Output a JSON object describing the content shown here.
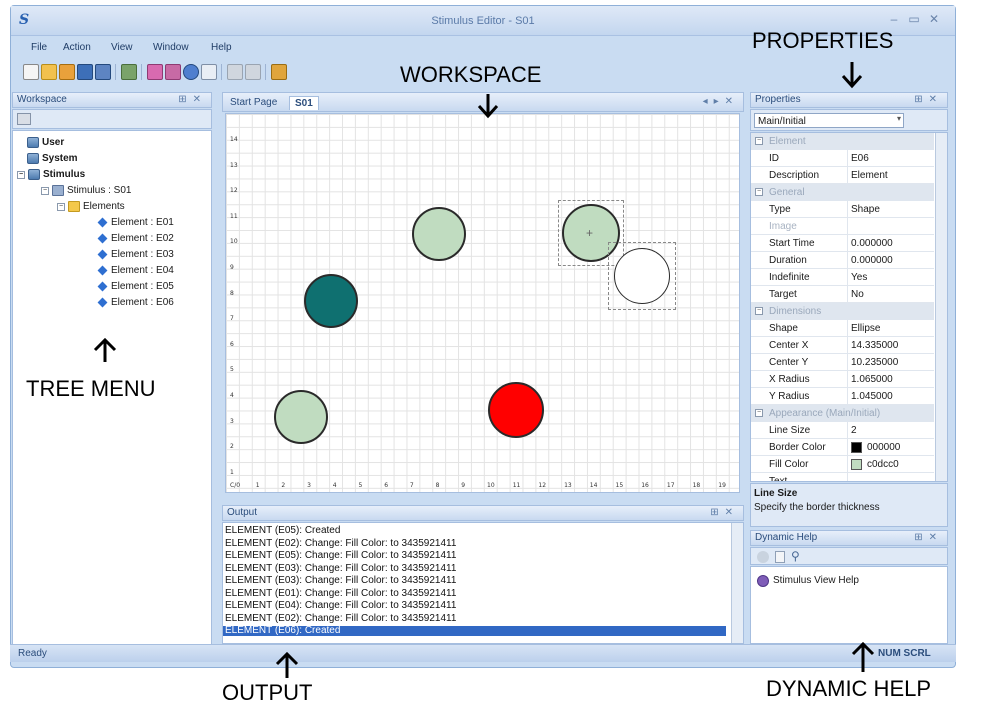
{
  "window": {
    "title": "Stimulus Editor - S01",
    "logo": "S"
  },
  "menu": [
    "File",
    "Action",
    "View",
    "Window",
    "Help"
  ],
  "workspace_panel": {
    "title": "Workspace",
    "tree": {
      "roots": [
        "User",
        "System",
        "Stimulus"
      ],
      "stimulus": "Stimulus : S01",
      "elements_folder": "Elements",
      "elements": [
        "Element : E01",
        "Element : E02",
        "Element : E03",
        "Element : E04",
        "Element : E05",
        "Element : E06"
      ]
    }
  },
  "doc_tabs": [
    "Start Page",
    "S01"
  ],
  "canvas": {
    "x_ticks": [
      "C/0",
      "1",
      "2",
      "3",
      "4",
      "5",
      "6",
      "7",
      "8",
      "9",
      "10",
      "11",
      "12",
      "13",
      "14",
      "15",
      "16",
      "17",
      "18",
      "19"
    ],
    "y_ticks": [
      "14",
      "13",
      "12",
      "11",
      "10",
      "9",
      "8",
      "7",
      "6",
      "5",
      "4",
      "3",
      "2",
      "1"
    ],
    "colors": {
      "light_green": "#c0dcc0",
      "teal": "#0f7070",
      "red": "#ff0000",
      "white": "#ffffff"
    }
  },
  "output_panel": {
    "title": "Output",
    "lines": [
      "ELEMENT (E05): Created",
      "ELEMENT (E02): Change: Fill Color: to 3435921411",
      "ELEMENT (E05): Change: Fill Color: to 3435921411",
      "ELEMENT (E03): Change: Fill Color: to 3435921411",
      "ELEMENT (E03): Change: Fill Color: to 3435921411",
      "ELEMENT (E01): Change: Fill Color: to 3435921411",
      "ELEMENT (E04): Change: Fill Color: to 3435921411",
      "ELEMENT (E02): Change: Fill Color: to 3435921411",
      "ELEMENT (E06): Created"
    ]
  },
  "properties_panel": {
    "title": "Properties",
    "dropdown": "Main/Initial",
    "categories": {
      "element": "Element",
      "general": "General",
      "dimensions": "Dimensions",
      "appearance": "Appearance (Main/Initial)"
    },
    "element_rows": [
      {
        "k": "ID",
        "v": "E06"
      },
      {
        "k": "Description",
        "v": "Element"
      }
    ],
    "general_rows": [
      {
        "k": "Type",
        "v": "Shape"
      },
      {
        "k": "Image",
        "v": ""
      },
      {
        "k": "Start Time",
        "v": "0.000000"
      },
      {
        "k": "Duration",
        "v": "0.000000"
      },
      {
        "k": "Indefinite",
        "v": "Yes"
      },
      {
        "k": "Target",
        "v": "No"
      }
    ],
    "dimension_rows": [
      {
        "k": "Shape",
        "v": "Ellipse"
      },
      {
        "k": "Center X",
        "v": "14.335000"
      },
      {
        "k": "Center Y",
        "v": "10.235000"
      },
      {
        "k": "X Radius",
        "v": "1.065000"
      },
      {
        "k": "Y Radius",
        "v": "1.045000"
      }
    ],
    "appearance_rows": [
      {
        "k": "Line Size",
        "v": "2"
      },
      {
        "k": "Border Color",
        "v": "000000"
      },
      {
        "k": "Fill Color",
        "v": "c0dcc0"
      },
      {
        "k": "Text",
        "v": ""
      }
    ],
    "border_swatch": "#000000",
    "fill_swatch": "#c0dcc0",
    "help_title": "Line Size",
    "help_text": "Specify the border thickness"
  },
  "dynamic_help": {
    "title": "Dynamic Help",
    "link": "Stimulus View Help"
  },
  "status": {
    "left": "Ready",
    "right": "NUM SCRL"
  },
  "annotations": {
    "workspace": "WORKSPACE",
    "properties": "PROPERTIES",
    "tree_menu": "TREE MENU",
    "output": "OUTPUT",
    "dynamic_help": "DYNAMIC HELP"
  }
}
